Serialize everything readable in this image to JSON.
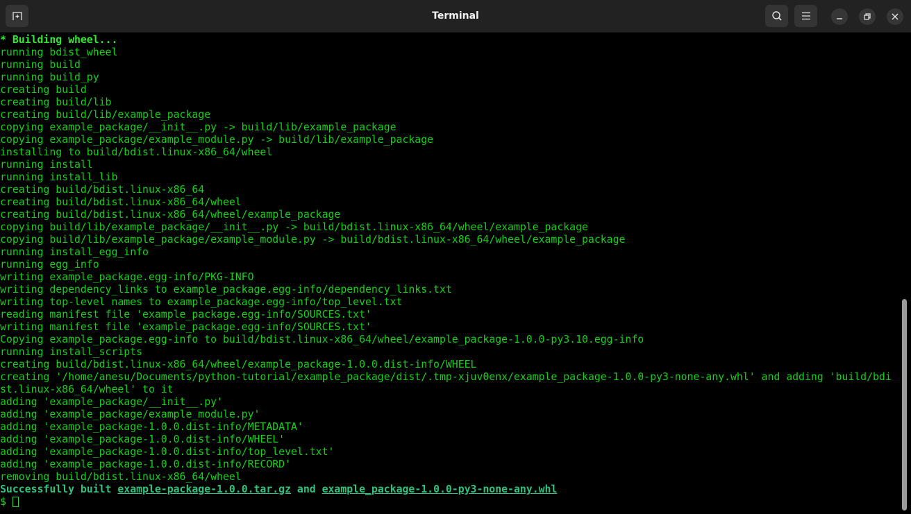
{
  "window": {
    "title": "Terminal",
    "buttons": {
      "new_tab": "new-tab-icon",
      "search": "search-icon",
      "menu": "hamburger-menu-icon",
      "minimize": "minimize-icon",
      "maximize": "restore-icon",
      "close": "close-icon"
    }
  },
  "terminal": {
    "lines": [
      "* Building wheel...",
      "running bdist_wheel",
      "running build",
      "running build_py",
      "creating build",
      "creating build/lib",
      "creating build/lib/example_package",
      "copying example_package/__init__.py -> build/lib/example_package",
      "copying example_package/example_module.py -> build/lib/example_package",
      "installing to build/bdist.linux-x86_64/wheel",
      "running install",
      "running install_lib",
      "creating build/bdist.linux-x86_64",
      "creating build/bdist.linux-x86_64/wheel",
      "creating build/bdist.linux-x86_64/wheel/example_package",
      "copying build/lib/example_package/__init__.py -> build/bdist.linux-x86_64/wheel/example_package",
      "copying build/lib/example_package/example_module.py -> build/bdist.linux-x86_64/wheel/example_package",
      "running install_egg_info",
      "running egg_info",
      "writing example_package.egg-info/PKG-INFO",
      "writing dependency_links to example_package.egg-info/dependency_links.txt",
      "writing top-level names to example_package.egg-info/top_level.txt",
      "reading manifest file 'example_package.egg-info/SOURCES.txt'",
      "writing manifest file 'example_package.egg-info/SOURCES.txt'",
      "Copying example_package.egg-info to build/bdist.linux-x86_64/wheel/example_package-1.0.0-py3.10.egg-info",
      "running install_scripts",
      "creating build/bdist.linux-x86_64/wheel/example_package-1.0.0.dist-info/WHEEL",
      "creating '/home/anesu/Documents/python-tutorial/example_package/dist/.tmp-xjuv0enx/example_package-1.0.0-py3-none-any.whl' and adding 'build/bdi",
      "st.linux-x86_64/wheel' to it",
      "adding 'example_package/__init__.py'",
      "adding 'example_package/example_module.py'",
      "adding 'example_package-1.0.0.dist-info/METADATA'",
      "adding 'example_package-1.0.0.dist-info/WHEEL'",
      "adding 'example_package-1.0.0.dist-info/top_level.txt'",
      "adding 'example_package-1.0.0.dist-info/RECORD'",
      "removing build/bdist.linux-x86_64/wheel"
    ],
    "success": {
      "prefix": "Successfully built ",
      "sdist": "example-package-1.0.0.tar.gz",
      "joiner": " and ",
      "wheel": "example_package-1.0.0-py3-none-any.whl"
    },
    "prompt": "$ "
  },
  "colors": {
    "text": "#12d012",
    "success": "#2ec27e",
    "background": "#000000",
    "titlebar": "#222222"
  }
}
